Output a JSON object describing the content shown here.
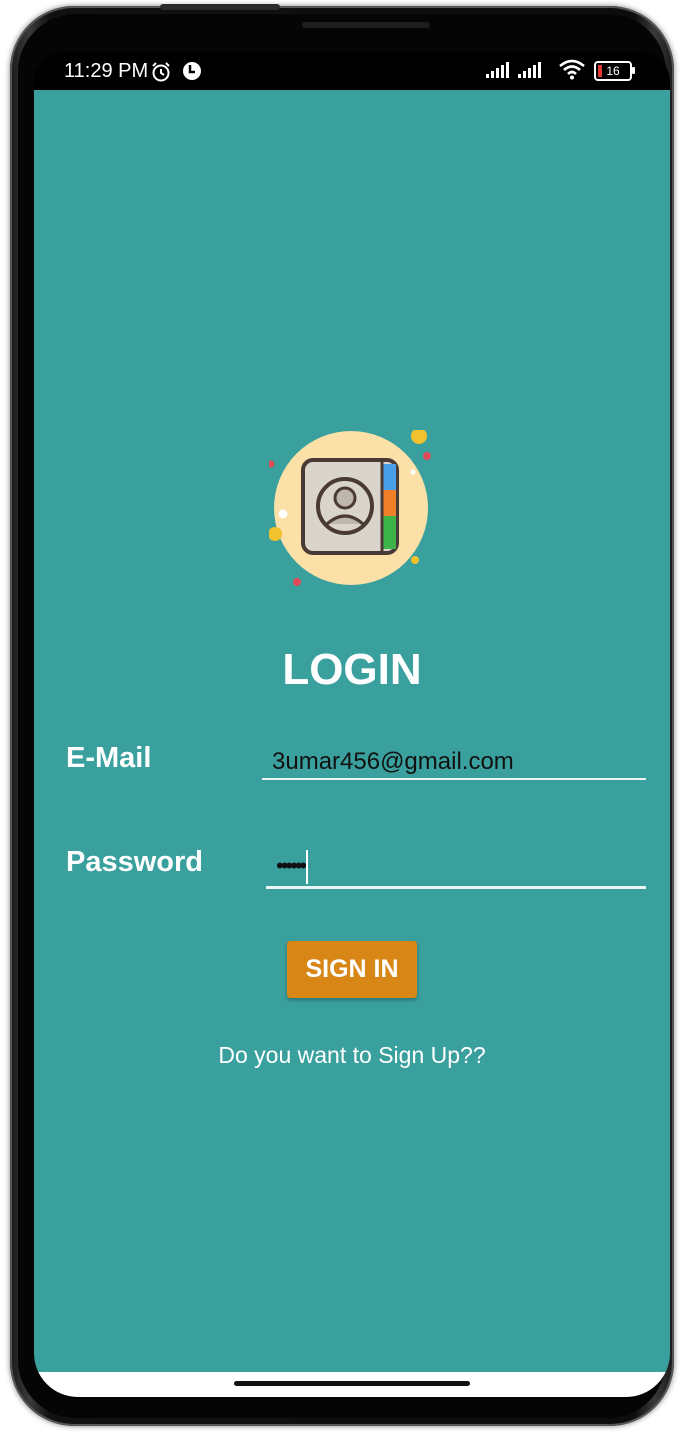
{
  "status_bar": {
    "time": "11:29 PM",
    "battery": "16"
  },
  "login": {
    "title": "LOGIN",
    "email_label": "E-Mail",
    "email_value": "3umar456@gmail.com",
    "password_label": "Password",
    "password_value": "••••••",
    "signin_label": "SIGN IN",
    "signup_link": "Do you want to Sign Up??"
  },
  "colors": {
    "background": "#3aa09e",
    "button": "#d88717",
    "logo_circle": "#fbe0a8"
  },
  "icons": {
    "logo": "contact-book-icon",
    "alarm": "alarm-icon",
    "notification": "notification-icon",
    "signal": "signal-icon",
    "wifi": "wifi-icon",
    "battery": "battery-icon"
  }
}
